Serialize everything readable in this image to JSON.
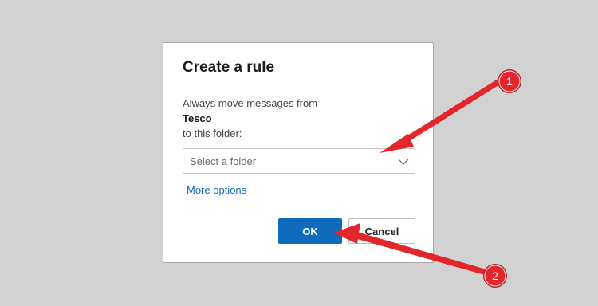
{
  "dialog": {
    "title": "Create a rule",
    "line1": "Always move messages from",
    "sender": "Tesco",
    "line3": "to this folder:",
    "folder_select": {
      "placeholder": "Select a folder",
      "icon": "chevron-down-icon"
    },
    "more_options": "More options",
    "ok_label": "OK",
    "cancel_label": "Cancel"
  },
  "annotations": [
    {
      "label": "1"
    },
    {
      "label": "2"
    }
  ],
  "colors": {
    "background": "#d2d2d2",
    "accent": "#0f6cbd",
    "annotation": "#e3262b"
  }
}
